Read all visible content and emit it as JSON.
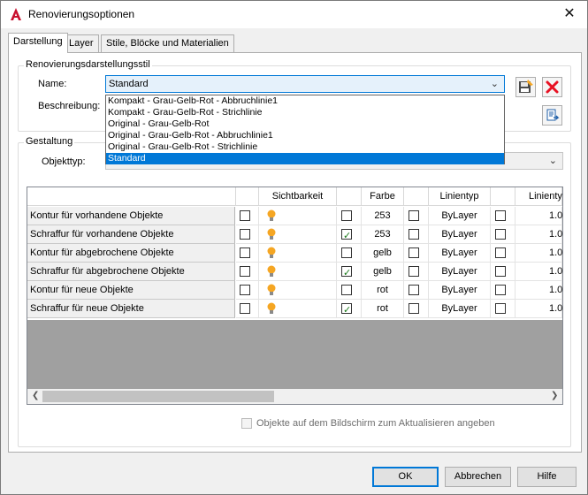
{
  "window": {
    "title": "Renovierungsoptionen",
    "close_glyph": "✕"
  },
  "tabs": [
    {
      "label": "Darstellung",
      "active": true
    },
    {
      "label": "Layer",
      "active": false
    },
    {
      "label": "Stile, Blöcke und Materialien",
      "active": false
    }
  ],
  "style_group": {
    "label": "Renovierungsdarstellungsstil",
    "name_label": "Name:",
    "name_value": "Standard",
    "description_label": "Beschreibung:",
    "dropdown_options": [
      {
        "text": "Kompakt - Grau-Gelb-Rot - Abbruchlinie1",
        "selected": false
      },
      {
        "text": "Kompakt - Grau-Gelb-Rot - Strichlinie",
        "selected": false
      },
      {
        "text": "Original - Grau-Gelb-Rot",
        "selected": false
      },
      {
        "text": "Original - Grau-Gelb-Rot - Abbruchlinie1",
        "selected": false
      },
      {
        "text": "Original - Grau-Gelb-Rot - Strichlinie",
        "selected": false
      },
      {
        "text": "Standard",
        "selected": true
      }
    ]
  },
  "design_group": {
    "label": "Gestaltung",
    "object_type_label": "Objekttyp:"
  },
  "table": {
    "columns": [
      "",
      "Sichtbarkeit",
      "",
      "Farbe",
      "",
      "Linientyp",
      "",
      "Linienty"
    ],
    "rows": [
      {
        "name": "Kontur für vorhandene Objekte",
        "color": "253",
        "linetype": "ByLayer",
        "lineweight": "1.0",
        "checked": false
      },
      {
        "name": "Schraffur für vorhandene Objekte",
        "color": "253",
        "linetype": "ByLayer",
        "lineweight": "1.0",
        "checked": true
      },
      {
        "name": "Kontur für abgebrochene Objekte",
        "color": "gelb",
        "linetype": "ByLayer",
        "lineweight": "1.0",
        "checked": false
      },
      {
        "name": "Schraffur für abgebrochene Objekte",
        "color": "gelb",
        "linetype": "ByLayer",
        "lineweight": "1.0",
        "checked": true
      },
      {
        "name": "Kontur für neue Objekte",
        "color": "rot",
        "linetype": "ByLayer",
        "lineweight": "1.0",
        "checked": false
      },
      {
        "name": "Schraffur für neue Objekte",
        "color": "rot",
        "linetype": "ByLayer",
        "lineweight": "1.0",
        "checked": true
      }
    ]
  },
  "footer": {
    "checkbox_label": "Objekte auf dem Bildschirm zum Aktualisieren angeben"
  },
  "buttons": {
    "ok": "OK",
    "cancel": "Abbrechen",
    "help": "Hilfe"
  },
  "colors": {
    "accent": "#0078d7",
    "delete_red": "#e81123",
    "bulb": "#f5a623"
  }
}
